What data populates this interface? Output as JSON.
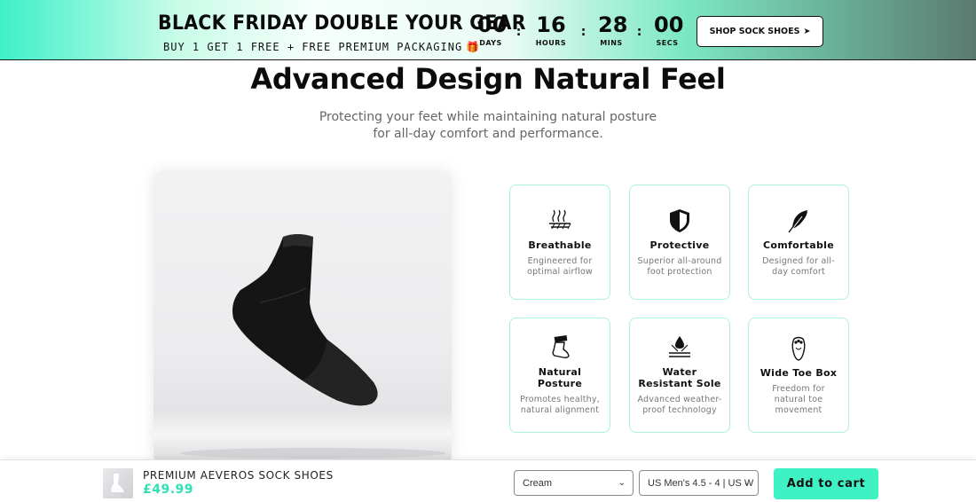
{
  "banner": {
    "headline": "BLACK FRIDAY DOUBLE YOUR GEAR",
    "subline": "BUY 1 GET 1 FREE + FREE PREMIUM PACKAGING",
    "gift_icon": "gift-icon",
    "countdown": [
      {
        "value": "00",
        "label": "DAYS"
      },
      {
        "value": "16",
        "label": "HOURS"
      },
      {
        "value": "28",
        "label": "MINS"
      },
      {
        "value": "00",
        "label": "SECS"
      }
    ],
    "separator": ":",
    "cta_label": "SHOP SOCK SHOES",
    "cta_arrow": "➤"
  },
  "section": {
    "title": "Advanced Design Natural Feel",
    "subtitle_line1": "Protecting your feet while maintaining natural posture",
    "subtitle_line2": "for all-day comfort and performance."
  },
  "features": [
    {
      "icon": "breathable-icon",
      "title": "Breathable",
      "desc": "Engineered for optimal airflow"
    },
    {
      "icon": "shield-icon",
      "title": "Protective",
      "desc": "Superior all-around foot protection"
    },
    {
      "icon": "feather-icon",
      "title": "Comfortable",
      "desc": "Designed for all-day comfort"
    },
    {
      "icon": "foot-posture-icon",
      "title": "Natural Posture",
      "desc": "Promotes healthy, natural alignment"
    },
    {
      "icon": "water-drop-icon",
      "title": "Water Resistant Sole",
      "desc": "Advanced weather-proof technology"
    },
    {
      "icon": "toe-box-icon",
      "title": "Wide Toe Box",
      "desc": "Freedom for natural toe movement"
    }
  ],
  "sticky_bar": {
    "product_name": "PREMIUM AEVEROS SOCK SHOES",
    "price": "£49.99",
    "color_select": "Cream",
    "size_select": "US Men's 4.5 - 4 | US W",
    "add_to_cart": "Add to cart"
  },
  "colors": {
    "accent": "#3ef2c4",
    "price": "#2fe0b4",
    "card_border": "#a9f2dc"
  }
}
